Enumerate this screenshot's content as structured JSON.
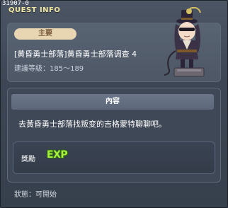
{
  "window": {
    "id": "31907-0",
    "title": "QUEST INFO"
  },
  "quest": {
    "type_badge": "主要",
    "name": "[黄昏勇士部落]黄昏勇士部落调查 4",
    "level_label": "建議等級",
    "level_value": "185～189",
    "npc_icon": "npc-character-icon"
  },
  "content": {
    "header": "內容",
    "text": "去黃昏勇士部落找叛变的吉格蒙特聊聊吧。"
  },
  "reward": {
    "label": "獎勵",
    "exp_icon": "EXP"
  },
  "status": {
    "label": "狀態",
    "value": "可開始"
  },
  "colors": {
    "title": "#f0e6a0",
    "badge_bg": "#e8d6b2",
    "exp_green": "#a8f040"
  }
}
